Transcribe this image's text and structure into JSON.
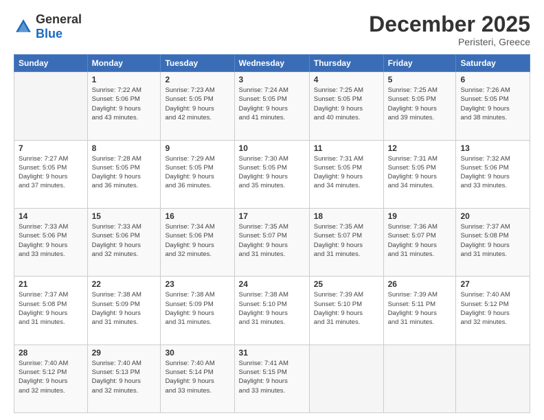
{
  "logo": {
    "text_general": "General",
    "text_blue": "Blue"
  },
  "header": {
    "month_title": "December 2025",
    "location": "Peristeri, Greece"
  },
  "days_of_week": [
    "Sunday",
    "Monday",
    "Tuesday",
    "Wednesday",
    "Thursday",
    "Friday",
    "Saturday"
  ],
  "weeks": [
    [
      {
        "day": "",
        "info": ""
      },
      {
        "day": "1",
        "info": "Sunrise: 7:22 AM\nSunset: 5:06 PM\nDaylight: 9 hours\nand 43 minutes."
      },
      {
        "day": "2",
        "info": "Sunrise: 7:23 AM\nSunset: 5:05 PM\nDaylight: 9 hours\nand 42 minutes."
      },
      {
        "day": "3",
        "info": "Sunrise: 7:24 AM\nSunset: 5:05 PM\nDaylight: 9 hours\nand 41 minutes."
      },
      {
        "day": "4",
        "info": "Sunrise: 7:25 AM\nSunset: 5:05 PM\nDaylight: 9 hours\nand 40 minutes."
      },
      {
        "day": "5",
        "info": "Sunrise: 7:25 AM\nSunset: 5:05 PM\nDaylight: 9 hours\nand 39 minutes."
      },
      {
        "day": "6",
        "info": "Sunrise: 7:26 AM\nSunset: 5:05 PM\nDaylight: 9 hours\nand 38 minutes."
      }
    ],
    [
      {
        "day": "7",
        "info": "Sunrise: 7:27 AM\nSunset: 5:05 PM\nDaylight: 9 hours\nand 37 minutes."
      },
      {
        "day": "8",
        "info": "Sunrise: 7:28 AM\nSunset: 5:05 PM\nDaylight: 9 hours\nand 36 minutes."
      },
      {
        "day": "9",
        "info": "Sunrise: 7:29 AM\nSunset: 5:05 PM\nDaylight: 9 hours\nand 36 minutes."
      },
      {
        "day": "10",
        "info": "Sunrise: 7:30 AM\nSunset: 5:05 PM\nDaylight: 9 hours\nand 35 minutes."
      },
      {
        "day": "11",
        "info": "Sunrise: 7:31 AM\nSunset: 5:05 PM\nDaylight: 9 hours\nand 34 minutes."
      },
      {
        "day": "12",
        "info": "Sunrise: 7:31 AM\nSunset: 5:05 PM\nDaylight: 9 hours\nand 34 minutes."
      },
      {
        "day": "13",
        "info": "Sunrise: 7:32 AM\nSunset: 5:06 PM\nDaylight: 9 hours\nand 33 minutes."
      }
    ],
    [
      {
        "day": "14",
        "info": "Sunrise: 7:33 AM\nSunset: 5:06 PM\nDaylight: 9 hours\nand 33 minutes."
      },
      {
        "day": "15",
        "info": "Sunrise: 7:33 AM\nSunset: 5:06 PM\nDaylight: 9 hours\nand 32 minutes."
      },
      {
        "day": "16",
        "info": "Sunrise: 7:34 AM\nSunset: 5:06 PM\nDaylight: 9 hours\nand 32 minutes."
      },
      {
        "day": "17",
        "info": "Sunrise: 7:35 AM\nSunset: 5:07 PM\nDaylight: 9 hours\nand 31 minutes."
      },
      {
        "day": "18",
        "info": "Sunrise: 7:35 AM\nSunset: 5:07 PM\nDaylight: 9 hours\nand 31 minutes."
      },
      {
        "day": "19",
        "info": "Sunrise: 7:36 AM\nSunset: 5:07 PM\nDaylight: 9 hours\nand 31 minutes."
      },
      {
        "day": "20",
        "info": "Sunrise: 7:37 AM\nSunset: 5:08 PM\nDaylight: 9 hours\nand 31 minutes."
      }
    ],
    [
      {
        "day": "21",
        "info": "Sunrise: 7:37 AM\nSunset: 5:08 PM\nDaylight: 9 hours\nand 31 minutes."
      },
      {
        "day": "22",
        "info": "Sunrise: 7:38 AM\nSunset: 5:09 PM\nDaylight: 9 hours\nand 31 minutes."
      },
      {
        "day": "23",
        "info": "Sunrise: 7:38 AM\nSunset: 5:09 PM\nDaylight: 9 hours\nand 31 minutes."
      },
      {
        "day": "24",
        "info": "Sunrise: 7:38 AM\nSunset: 5:10 PM\nDaylight: 9 hours\nand 31 minutes."
      },
      {
        "day": "25",
        "info": "Sunrise: 7:39 AM\nSunset: 5:10 PM\nDaylight: 9 hours\nand 31 minutes."
      },
      {
        "day": "26",
        "info": "Sunrise: 7:39 AM\nSunset: 5:11 PM\nDaylight: 9 hours\nand 31 minutes."
      },
      {
        "day": "27",
        "info": "Sunrise: 7:40 AM\nSunset: 5:12 PM\nDaylight: 9 hours\nand 32 minutes."
      }
    ],
    [
      {
        "day": "28",
        "info": "Sunrise: 7:40 AM\nSunset: 5:12 PM\nDaylight: 9 hours\nand 32 minutes."
      },
      {
        "day": "29",
        "info": "Sunrise: 7:40 AM\nSunset: 5:13 PM\nDaylight: 9 hours\nand 32 minutes."
      },
      {
        "day": "30",
        "info": "Sunrise: 7:40 AM\nSunset: 5:14 PM\nDaylight: 9 hours\nand 33 minutes."
      },
      {
        "day": "31",
        "info": "Sunrise: 7:41 AM\nSunset: 5:15 PM\nDaylight: 9 hours\nand 33 minutes."
      },
      {
        "day": "",
        "info": ""
      },
      {
        "day": "",
        "info": ""
      },
      {
        "day": "",
        "info": ""
      }
    ]
  ]
}
